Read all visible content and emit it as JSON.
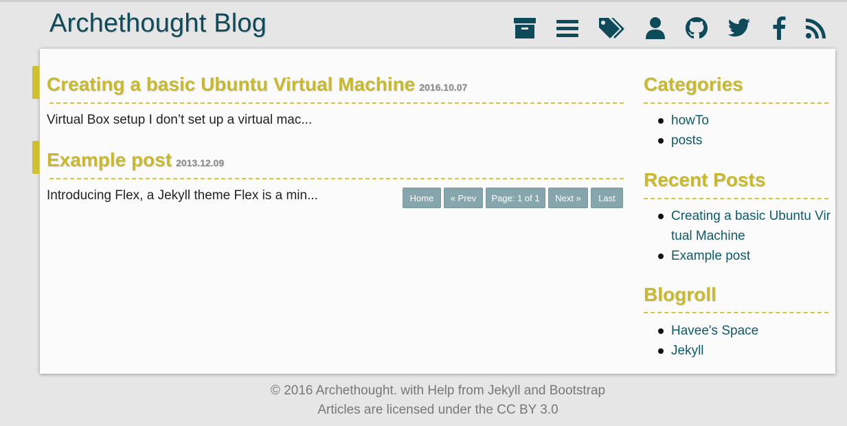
{
  "header": {
    "site_title": "Archethought Blog",
    "nav_icons": [
      "archive-icon",
      "list-icon",
      "tags-icon",
      "user-icon",
      "github-icon",
      "twitter-icon",
      "facebook-icon",
      "rss-icon"
    ]
  },
  "colors": {
    "accent": "#c9b92c",
    "brand": "#0d4a5a",
    "link": "#0d5a6a",
    "pager_bg": "#86a6ad"
  },
  "posts": [
    {
      "title": "Creating a basic Ubuntu Virtual Machine",
      "date": "2016.10.07",
      "excerpt": "Virtual Box setup I don’t set up a virtual mac..."
    },
    {
      "title": "Example post",
      "date": "2013.12.09",
      "excerpt": "Introducing Flex, a Jekyll theme Flex is a min..."
    }
  ],
  "pager": {
    "home": "Home",
    "prev": "« Prev",
    "page": "Page: 1 of 1",
    "next": "Next »",
    "last": "Last"
  },
  "sidebar": {
    "categories": {
      "heading": "Categories",
      "items": [
        "howTo",
        "posts"
      ]
    },
    "recent": {
      "heading": "Recent Posts",
      "items": [
        "Creating a basic Ubuntu Vir",
        "tual Machine",
        "Example post"
      ]
    },
    "blogroll": {
      "heading": "Blogroll",
      "items": [
        "Havee's Space",
        "Jekyll"
      ]
    }
  },
  "footer": {
    "line1": "© 2016 Archethought. with Help from Jekyll and Bootstrap",
    "line2": "Articles are licensed under the CC BY 3.0"
  }
}
